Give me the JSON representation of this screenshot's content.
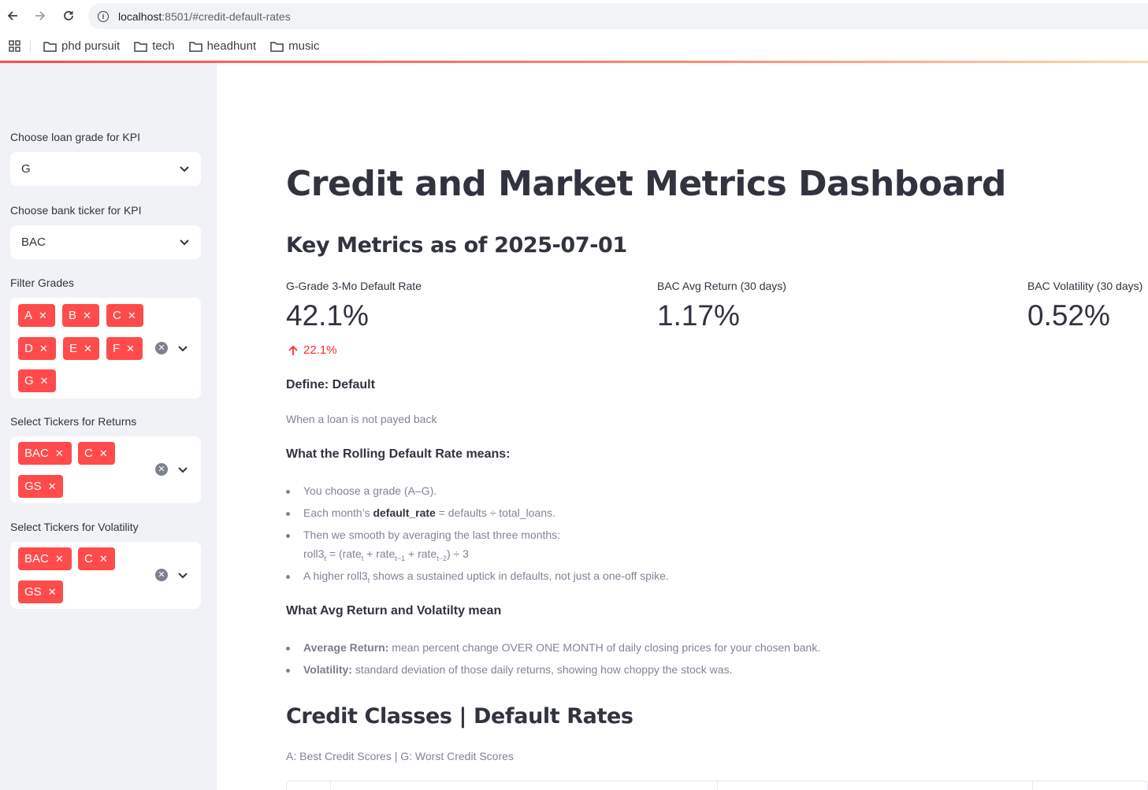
{
  "browser": {
    "url_host": "localhost",
    "url_path": ":8501/#credit-default-rates",
    "bookmarks": [
      "phd pursuit",
      "tech",
      "headhunt",
      "music"
    ]
  },
  "sidebar": {
    "grade_label": "Choose loan grade for KPI",
    "grade_value": "G",
    "ticker_label": "Choose bank ticker for KPI",
    "ticker_value": "BAC",
    "filter_grades_label": "Filter Grades",
    "filter_grades": [
      "A",
      "B",
      "C",
      "D",
      "E",
      "F",
      "G"
    ],
    "returns_label": "Select Tickers for Returns",
    "returns_tickers": [
      "BAC",
      "C",
      "GS"
    ],
    "volatility_label": "Select Tickers for Volatility",
    "volatility_tickers": [
      "BAC",
      "C",
      "GS"
    ]
  },
  "main": {
    "title": "Credit and Market Metrics Dashboard",
    "key_metrics_heading": "Key Metrics as of 2025-07-01",
    "metrics": [
      {
        "label": "G-Grade 3-Mo Default Rate",
        "value": "42.1%",
        "delta": "22.1%",
        "delta_direction": "up",
        "delta_color": "#ff2b2b"
      },
      {
        "label": "BAC Avg Return (30 days)",
        "value": "1.17%"
      },
      {
        "label": "BAC Volatility (30 days)",
        "value": "0.52%"
      }
    ],
    "define_heading": "Define: Default",
    "define_text": "When a loan is not payed back",
    "rolling_heading": "What the Rolling Default Rate means:",
    "rolling_bullets": {
      "b1": "You choose a grade (A–G).",
      "b2_pre": "Each month’s ",
      "b2_bold": "default_rate",
      "b2_post": " = defaults ÷ total_loans.",
      "b3_line1": "Then we smooth by averaging the last three months:",
      "b4_pre": "A higher roll3",
      "b4_post": " shows a sustained uptick in defaults, not just a one-off spike."
    },
    "avg_heading": "What Avg Return and Volatilty mean",
    "avg_bullets": {
      "a1_bold": "Average Return:",
      "a1_text": " mean percent change OVER ONE MONTH of daily closing prices for your chosen bank.",
      "a2_bold": "Volatility:",
      "a2_text": " standard deviation of those daily returns, showing how choppy the stock was."
    },
    "credit_heading": "Credit Classes | Default Rates",
    "credit_caption": "A: Best Credit Scores | G: Worst Credit Scores"
  },
  "colors": {
    "accent": "#ff4b4b",
    "sidebar_bg": "#f0f2f6",
    "text": "#31333f",
    "muted": "#808495"
  }
}
